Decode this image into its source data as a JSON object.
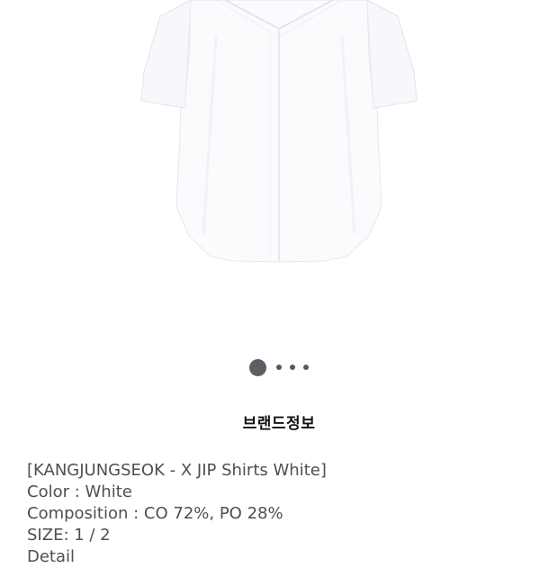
{
  "product": {
    "image_alt": "white short sleeve shirt",
    "colors": {
      "shirt": "#fbfbfe",
      "shadow": "#e8e9f0"
    }
  },
  "pager": {
    "count": 4,
    "active_index": 0
  },
  "brand_section": {
    "title": "브랜드정보"
  },
  "details": {
    "name_line": "[KANGJUNGSEOK - X JIP Shirts White]",
    "color_line": "Color : White",
    "composition_line": "Composition : CO 72%, PO 28%",
    "size_line": "SIZE: 1 / 2",
    "detail_line": "Detail"
  }
}
